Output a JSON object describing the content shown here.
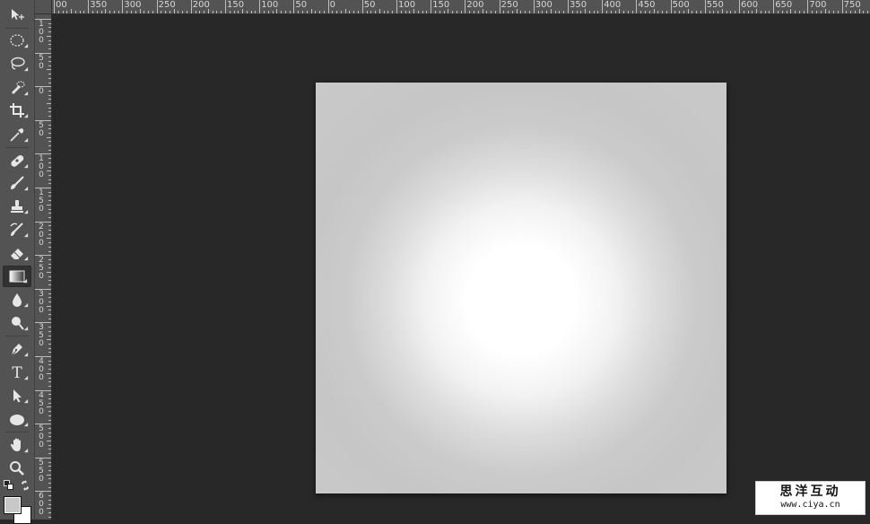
{
  "rulers": {
    "horizontal": {
      "labels": [
        "00",
        "350",
        "300",
        "250",
        "200",
        "150",
        "100",
        "50",
        "0",
        "50",
        "100",
        "150",
        "200",
        "250",
        "300",
        "350",
        "400",
        "450",
        "500",
        "550",
        "600",
        "650",
        "700",
        "750"
      ]
    },
    "vertical": {
      "labels": [
        "1\n0\n0",
        "5\n0",
        "0",
        "5\n0",
        "1\n0\n0",
        "1\n5\n0",
        "2\n0\n0",
        "2\n5\n0",
        "3\n0\n0",
        "3\n5\n0",
        "4\n0\n0",
        "4\n5\n0",
        "5\n0\n0",
        "5\n5\n0",
        "6\n0\n0"
      ]
    }
  },
  "toolbar": {
    "active_tool": "gradient-tool",
    "tools": [
      {
        "id": "move-tool",
        "icon": "move-icon"
      },
      {
        "id": "elliptical-marquee-tool",
        "icon": "ellipse-marquee-icon"
      },
      {
        "id": "lasso-tool",
        "icon": "lasso-icon"
      },
      {
        "id": "quick-selection-tool",
        "icon": "quick-selection-icon"
      },
      {
        "id": "crop-tool",
        "icon": "crop-icon"
      },
      {
        "id": "eyedropper-tool",
        "icon": "eyedropper-icon"
      },
      {
        "id": "spot-healing-tool",
        "icon": "bandage-icon"
      },
      {
        "id": "brush-tool",
        "icon": "brush-icon"
      },
      {
        "id": "clone-stamp-tool",
        "icon": "stamp-icon"
      },
      {
        "id": "history-brush-tool",
        "icon": "history-brush-icon"
      },
      {
        "id": "eraser-tool",
        "icon": "eraser-icon"
      },
      {
        "id": "gradient-tool",
        "icon": "gradient-icon"
      },
      {
        "id": "blur-tool",
        "icon": "drop-icon"
      },
      {
        "id": "dodge-tool",
        "icon": "dodge-icon"
      },
      {
        "id": "pen-tool",
        "icon": "pen-icon"
      },
      {
        "id": "type-tool",
        "icon": "type-icon",
        "label": "T"
      },
      {
        "id": "path-selection-tool",
        "icon": "arrow-icon"
      },
      {
        "id": "ellipse-tool",
        "icon": "ellipse-shape-icon"
      },
      {
        "id": "hand-tool",
        "icon": "hand-icon"
      },
      {
        "id": "zoom-tool",
        "icon": "zoom-icon"
      }
    ],
    "foreground_color": "#c8c8c8",
    "background_color": "#ffffff"
  },
  "document": {
    "fill": "radial-gradient",
    "center_color": "#ffffff",
    "edge_color": "#c6c6c6"
  },
  "watermark": {
    "title": "思洋互动",
    "url": "www.ciya.cn"
  },
  "colors": {
    "workspace": "#282828",
    "panel": "#535353"
  }
}
